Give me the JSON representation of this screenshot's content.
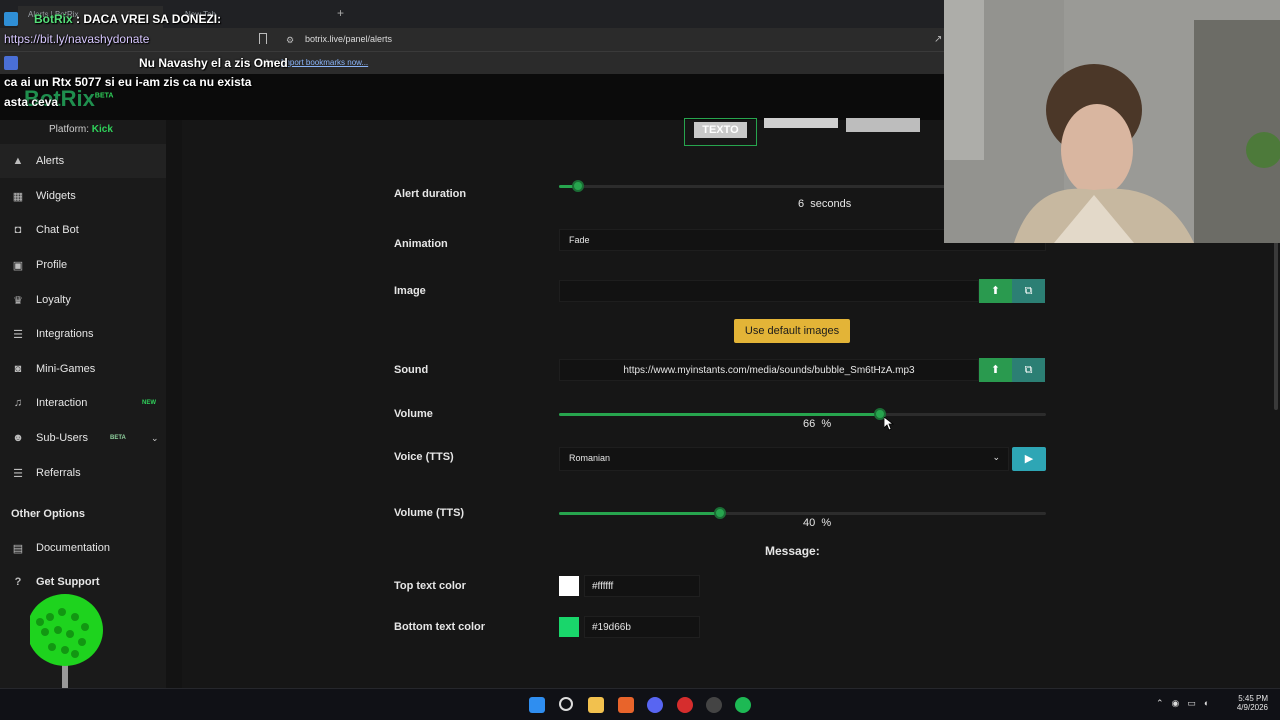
{
  "browser": {
    "tabs": [
      "Alerts | BotRix",
      "Cloud Streams",
      "New Tab"
    ],
    "new_tab_glyph": "+",
    "url": "botrix.live/panel/alerts",
    "bookmarks_fragment": "bar.",
    "import_link": "Import bookmarks now..."
  },
  "overlay": {
    "line1": ": DACA VREI SA DONEZI:",
    "line1_user": "BotRix",
    "line2": "https://bit.ly/navashydonate",
    "line3": "Nu Navashy el a zis Omed",
    "line4": "ca ai un Rtx 5077 si eu i-am zis ca nu exista",
    "line5": "asta ceva"
  },
  "brand": {
    "logo": "BotRix",
    "beta": "BETA"
  },
  "sidebar": {
    "platform_label": "Platform:",
    "platform_value": "Kick",
    "items": [
      {
        "label": "Alerts",
        "icon": "warning-icon"
      },
      {
        "label": "Widgets",
        "icon": "grid-icon"
      },
      {
        "label": "Chat Bot",
        "icon": "robot-icon"
      },
      {
        "label": "Profile",
        "icon": "profile-icon"
      },
      {
        "label": "Loyalty",
        "icon": "trophy-icon"
      },
      {
        "label": "Integrations",
        "icon": "list-icon"
      },
      {
        "label": "Mini-Games",
        "icon": "gamepad-icon"
      },
      {
        "label": "Interaction",
        "icon": "music-icon",
        "badge": "NEW"
      },
      {
        "label": "Sub-Users",
        "icon": "users-icon",
        "badge": "BETA"
      },
      {
        "label": "Referrals",
        "icon": "list-icon"
      }
    ],
    "other_options": "Other Options",
    "other_items": [
      {
        "label": "Documentation",
        "icon": "doc-icon"
      },
      {
        "label": "Get Support",
        "icon": "help-icon"
      }
    ]
  },
  "tabs": {
    "text_tab": "TEXTO"
  },
  "form": {
    "alert_duration": {
      "label": "Alert duration",
      "value": "6",
      "unit": "seconds",
      "level": 0.04
    },
    "animation": {
      "label": "Animation",
      "value": "Fade"
    },
    "image": {
      "label": "Image",
      "value": ""
    },
    "use_default": "Use default images",
    "sound": {
      "label": "Sound",
      "value": "https://www.myinstants.com/media/sounds/bubble_Sm6tHzA.mp3"
    },
    "volume": {
      "label": "Volume",
      "value": "66",
      "unit": "%",
      "level": 0.66
    },
    "voice": {
      "label": "Voice (TTS)",
      "value": "Romanian"
    },
    "volume_tts": {
      "label": "Volume (TTS)",
      "value": "40",
      "unit": "%",
      "level": 0.33
    },
    "message_heading": "Message:",
    "top_color": {
      "label": "Top text color",
      "value": "#ffffff"
    },
    "bottom_color": {
      "label": "Bottom text color",
      "value": "#19d66b"
    }
  },
  "taskbar": {
    "time": "5:45 PM",
    "date": "4/9/2026"
  },
  "colors": {
    "accent": "#27a54e",
    "yellow": "#e3b437",
    "teal": "#2ea6b5"
  }
}
